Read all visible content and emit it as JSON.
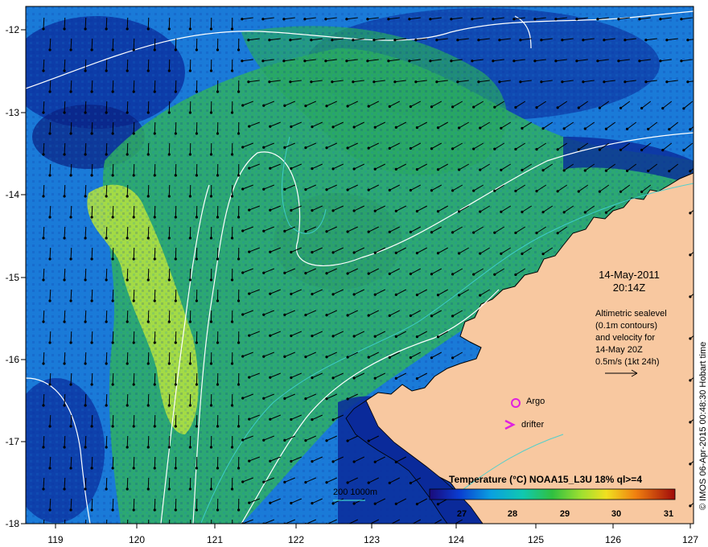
{
  "map": {
    "x_ticks": [
      "119",
      "120",
      "121",
      "122",
      "123",
      "124",
      "125",
      "126",
      "127"
    ],
    "y_ticks": [
      "-12",
      "-13",
      "-14",
      "-15",
      "-16",
      "-17",
      "-18"
    ],
    "date_line1": "14-May-2011",
    "date_line2": "20:14Z",
    "legend_lines": [
      "Altimetric sealevel",
      "(0.1m contours)",
      "and velocity for",
      "14-May 20Z",
      "0.5m/s (1kt 24h)"
    ],
    "argo_label": "Argo",
    "drifter_label": "drifter",
    "depth_label": "200  1000m",
    "colorbar_title": "Temperature (°C) NOAA15_L3U 18% ql>=4",
    "colorbar_ticks": [
      "27",
      "28",
      "29",
      "30",
      "31"
    ],
    "credit": "© IMOS 06-Apr-2015 00:48:30 Hobart time"
  },
  "colors": {
    "land": "#f8c8a0",
    "cold": "#0a1e8c",
    "mid": "#1fa86a",
    "warm": "#c8e640",
    "marker": "#e020e0",
    "depth_contour": "#40d0d0"
  }
}
